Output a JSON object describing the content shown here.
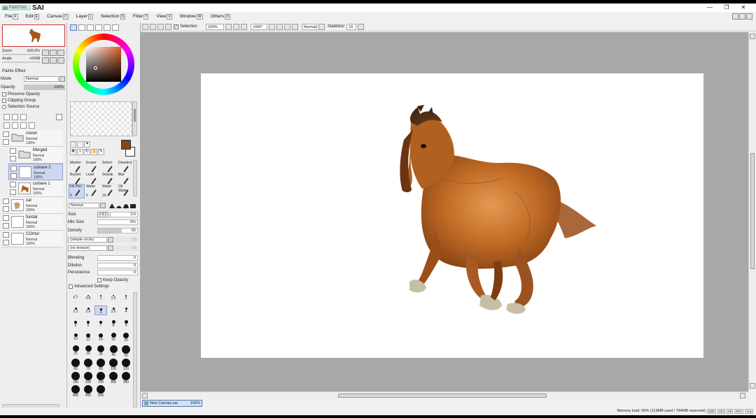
{
  "app": {
    "logo_small": "PaintTool",
    "logo_big": "SAI"
  },
  "window_controls": [
    "—",
    "❐",
    "✕"
  ],
  "menu": [
    {
      "label": "File",
      "key": "F"
    },
    {
      "label": "Edit",
      "key": "E"
    },
    {
      "label": "Canvas",
      "key": "C"
    },
    {
      "label": "Layer",
      "key": "L"
    },
    {
      "label": "Selection",
      "key": "S"
    },
    {
      "label": "Filter",
      "key": "T"
    },
    {
      "label": "View",
      "key": "V"
    },
    {
      "label": "Window",
      "key": "W"
    },
    {
      "label": "Others",
      "key": "O"
    }
  ],
  "navigator": {
    "zoom_label": "Zoom",
    "zoom_value": "100.0%",
    "angle_label": "Angle",
    "angle_value": "+000$"
  },
  "paint_effect": {
    "title": "Paints Effect",
    "mode_label": "Mode",
    "mode_value": "Normal",
    "opacity_label": "Opacity",
    "opacity_value": "100%",
    "preserve_opacity": "Preserve Opacity",
    "clipping_group": "Clipping Group",
    "selection_source": "Selection Source"
  },
  "layers": [
    {
      "name": "creion",
      "mode": "Normal",
      "opacity": "100%",
      "type": "folder",
      "selected": false
    },
    {
      "name": "Merged",
      "mode": "Normal",
      "opacity": "100%",
      "type": "folder",
      "selected": false
    },
    {
      "name": "culoare 2",
      "mode": "Normal",
      "opacity": "100%",
      "type": "layer",
      "selected": true
    },
    {
      "name": "culoare 1",
      "mode": "Normal",
      "opacity": "100%",
      "type": "layer",
      "selected": false
    },
    {
      "name": "cal",
      "mode": "Normal",
      "opacity": "100%",
      "type": "layer",
      "selected": false
    },
    {
      "name": "fundal",
      "mode": "Normal",
      "opacity": "100%",
      "type": "layer",
      "selected": false
    },
    {
      "name": "COntur",
      "mode": "Normal",
      "opacity": "100%",
      "type": "layer",
      "selected": false
    }
  ],
  "brushes": [
    {
      "label": "Marker",
      "sub": ""
    },
    {
      "label": "Eraser",
      "sub": ""
    },
    {
      "label": "Select",
      "sub": ""
    },
    {
      "label": "Deselect",
      "sub": ""
    },
    {
      "label": "Bucket",
      "sub": ""
    },
    {
      "label": "Lead",
      "sub": ""
    },
    {
      "label": "Smeak",
      "sub": ""
    },
    {
      "label": "Blur",
      "sub": ""
    },
    {
      "label": "Ink Pen",
      "sub": "5"
    },
    {
      "label": "Water",
      "sub": "5"
    },
    {
      "label": "Water",
      "sub": "10"
    },
    {
      "label": "Oil Water",
      "sub": ""
    }
  ],
  "brush_props": {
    "mode_value": "Normal",
    "size_label": "Size",
    "size_mult": "x 0.1",
    "size_value": "3.0",
    "min_size_label": "Min Size",
    "min_size_value": "0%",
    "density_label": "Density",
    "density_value": "60",
    "shape_value": "(simple circle)",
    "shape_strength": "50",
    "texture_value": "(no texture)",
    "texture_strength": "95",
    "blending_label": "Blending",
    "blending_value": "0",
    "dilution_label": "Dilution",
    "dilution_value": "0",
    "persistence_label": "Persistence",
    "persistence_value": "0",
    "keep_opacity": "Keep Opacity",
    "advanced_settings": "Advanced Settings"
  },
  "brush_sizes": [
    "0.7",
    "0.8",
    "1",
    "1.5",
    "2",
    "2.3",
    "2.6",
    "3",
    "3.5",
    "4",
    "5",
    "6",
    "7",
    "8",
    "9",
    "10",
    "12",
    "14",
    "16",
    "20",
    "25",
    "30",
    "35",
    "40",
    "50",
    "60",
    "70",
    "80",
    "100",
    "120",
    "160",
    "200",
    "250",
    "300",
    "350",
    "400",
    "450",
    "500"
  ],
  "canvas_toolbar": {
    "selection_label": "Selection",
    "zoom_value": "100%",
    "angle_value": "+000°",
    "blend_value": "Normal",
    "stabilizer_label": "Stabilizer",
    "stabilizer_value": "15"
  },
  "document_tab": {
    "name": "New Canvas.sai",
    "zoom": "100%"
  },
  "status": {
    "memory": "Memory load: 55% (119MB used / 784MB reserved)",
    "keys": [
      "Shift",
      "Ctrl",
      "Alt",
      "SPC",
      "Any"
    ]
  },
  "colors": {
    "foreground": "#7a4a24",
    "background": "#ffffff",
    "selection": "#cfd7ef"
  }
}
